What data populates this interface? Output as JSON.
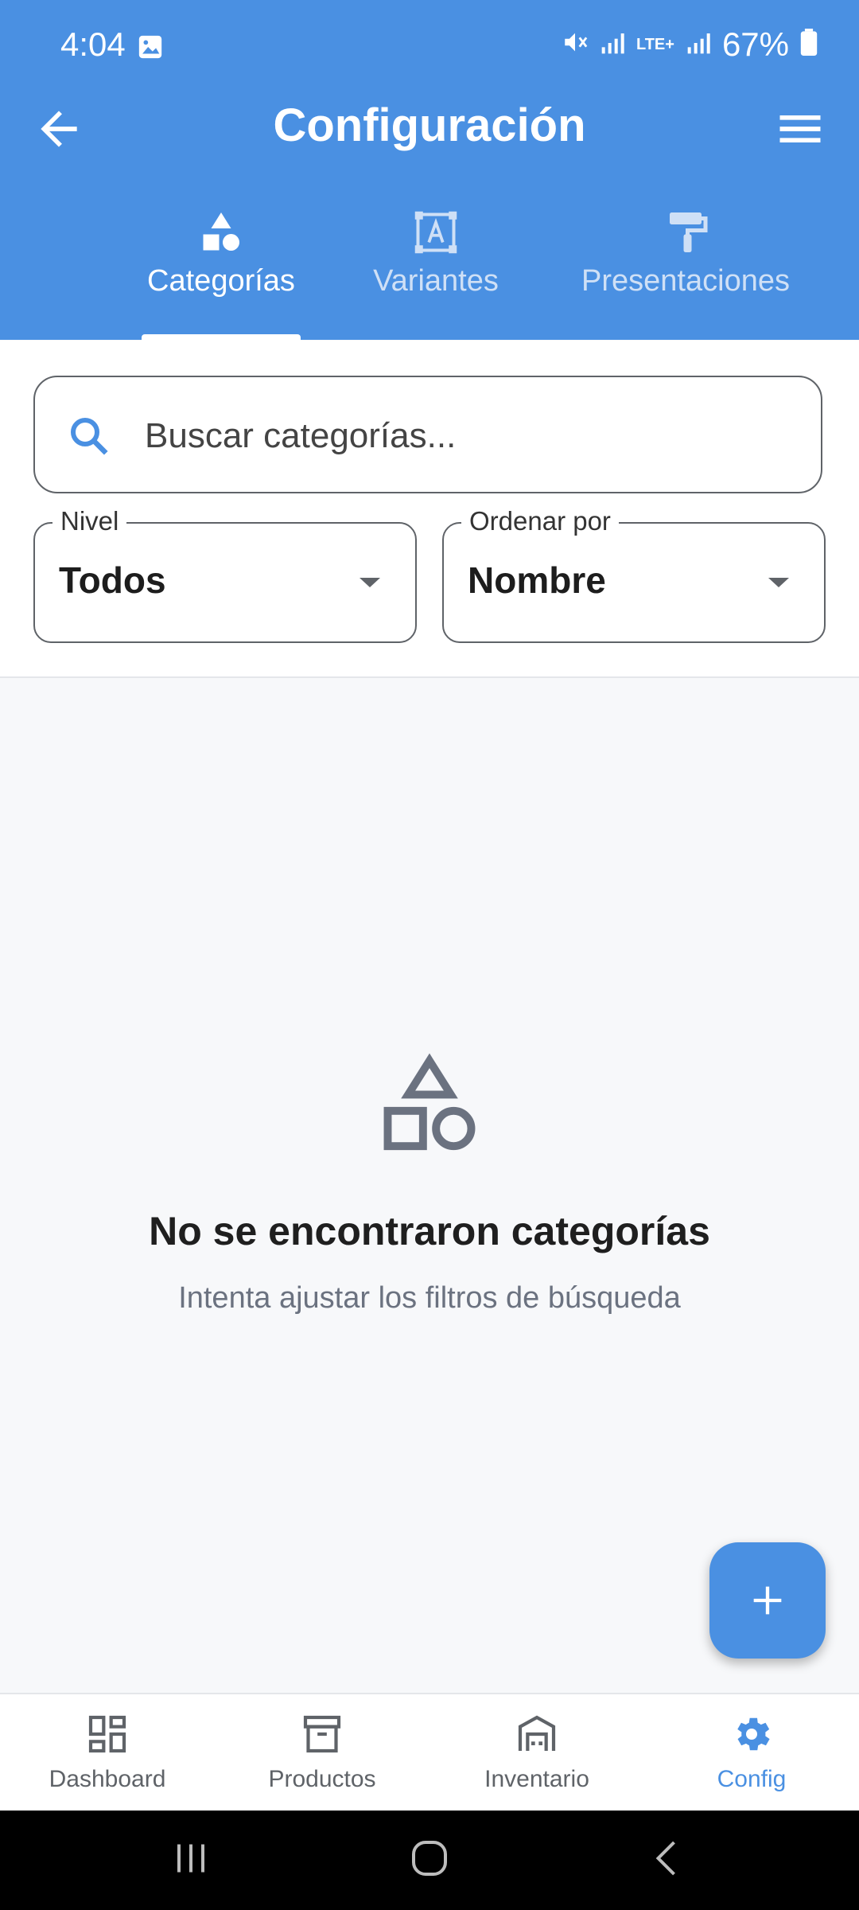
{
  "status_bar": {
    "time": "4:04",
    "battery": "67%",
    "network": "LTE+"
  },
  "appbar": {
    "title": "Configuración"
  },
  "tabs": [
    {
      "label": "Categorías",
      "icon": "shapes-icon",
      "active": true
    },
    {
      "label": "Variantes",
      "icon": "text-box-icon",
      "active": false
    },
    {
      "label": "Presentaciones",
      "icon": "paint-roller-icon",
      "active": false
    }
  ],
  "search": {
    "placeholder": "Buscar categorías...",
    "value": ""
  },
  "filters": {
    "level": {
      "label": "Nivel",
      "value": "Todos"
    },
    "sort": {
      "label": "Ordenar por",
      "value": "Nombre"
    }
  },
  "empty_state": {
    "title": "No se encontraron categorías",
    "subtitle": "Intenta ajustar los filtros de búsqueda"
  },
  "bottom_nav": [
    {
      "label": "Dashboard",
      "icon": "dashboard-icon",
      "active": false
    },
    {
      "label": "Productos",
      "icon": "archive-box-icon",
      "active": false
    },
    {
      "label": "Inventario",
      "icon": "warehouse-icon",
      "active": false
    },
    {
      "label": "Config",
      "icon": "gear-icon",
      "active": true
    }
  ],
  "colors": {
    "primary": "#4a90e2",
    "background": "#f7f8fa",
    "muted": "#6b7280"
  }
}
